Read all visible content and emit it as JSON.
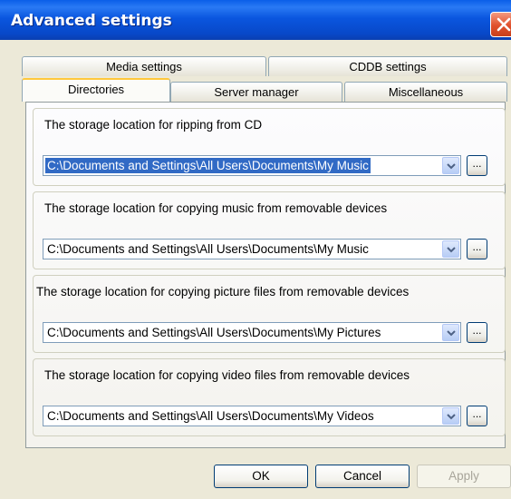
{
  "window": {
    "title": "Advanced settings"
  },
  "tabs": {
    "row_back": [
      {
        "label": "Media settings"
      },
      {
        "label": "CDDB settings"
      }
    ],
    "row_front": [
      {
        "label": "Directories",
        "active": true
      },
      {
        "label": "Server manager"
      },
      {
        "label": "Miscellaneous"
      }
    ]
  },
  "groups": [
    {
      "label": "The storage location for ripping from CD",
      "value": "C:\\Documents and Settings\\All Users\\Documents\\My Music",
      "selected": true
    },
    {
      "label": "The storage location for copying music from removable devices",
      "value": "C:\\Documents and Settings\\All Users\\Documents\\My Music",
      "selected": false
    },
    {
      "label": "The storage location for copying picture files from removable devices",
      "value": "C:\\Documents and Settings\\All Users\\Documents\\My Pictures",
      "selected": false
    },
    {
      "label": "The storage location for copying video files from removable devices",
      "value": "C:\\Documents and Settings\\All Users\\Documents\\My Videos",
      "selected": false
    }
  ],
  "browse_label": "...",
  "buttons": {
    "ok": "OK",
    "cancel": "Cancel",
    "apply": "Apply"
  },
  "colors": {
    "titlebar": "#0a56df",
    "selection": "#316ac5",
    "active_tab_accent": "#ffc83c"
  }
}
